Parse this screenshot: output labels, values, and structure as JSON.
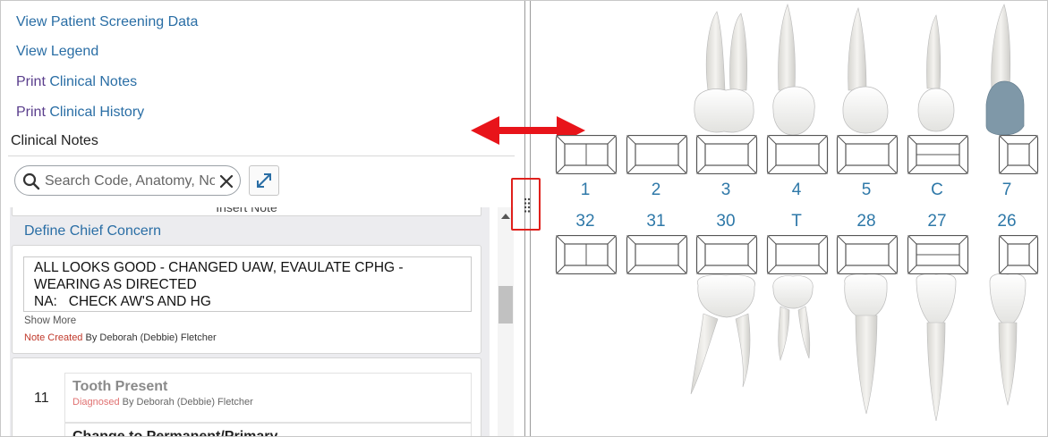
{
  "links": {
    "screening": "View Patient Screening Data",
    "legend": "View Legend",
    "print_notes_prefix": "Print ",
    "print_notes_rest": "Clinical Notes",
    "print_history_prefix": "Print ",
    "print_history_rest": "Clinical History"
  },
  "section_title": "Clinical Notes",
  "search": {
    "placeholder": "Search Code, Anatomy, Note",
    "clear_icon": "close-icon",
    "icon": "search-icon"
  },
  "expand_icon": "expand-arrows-icon",
  "notes": {
    "insert_label": "Insert Note",
    "chief_title": "Define Chief Concern",
    "note_text": "ALL LOOKS GOOD - CHANGED UAW, EVAULATE CPHG -\nWEARING AS DIRECTED\nNA:   CHECK AW'S AND HG",
    "show_more": "Show More",
    "created_status": "Note Created",
    "created_by": " By Deborah (Debbie) Fletcher"
  },
  "tooth_entry": {
    "number": "11",
    "title": "Tooth Present",
    "status": "Diagnosed",
    "by": " By Deborah (Debbie) Fletcher",
    "next_title": "Change to Permanent/Primary"
  },
  "chart": {
    "upper_numbers": [
      "1",
      "2",
      "3",
      "4",
      "5",
      "C",
      "7"
    ],
    "lower_numbers": [
      "32",
      "31",
      "30",
      "T",
      "28",
      "27",
      "26"
    ],
    "colors": {
      "number": "#2e78a8",
      "tooth": "#ebeae6",
      "shaded_crown": "#7f98a8"
    }
  },
  "splitter": {
    "icon": "drag-handle-icon",
    "arrow_icon": "double-arrow-icon"
  }
}
